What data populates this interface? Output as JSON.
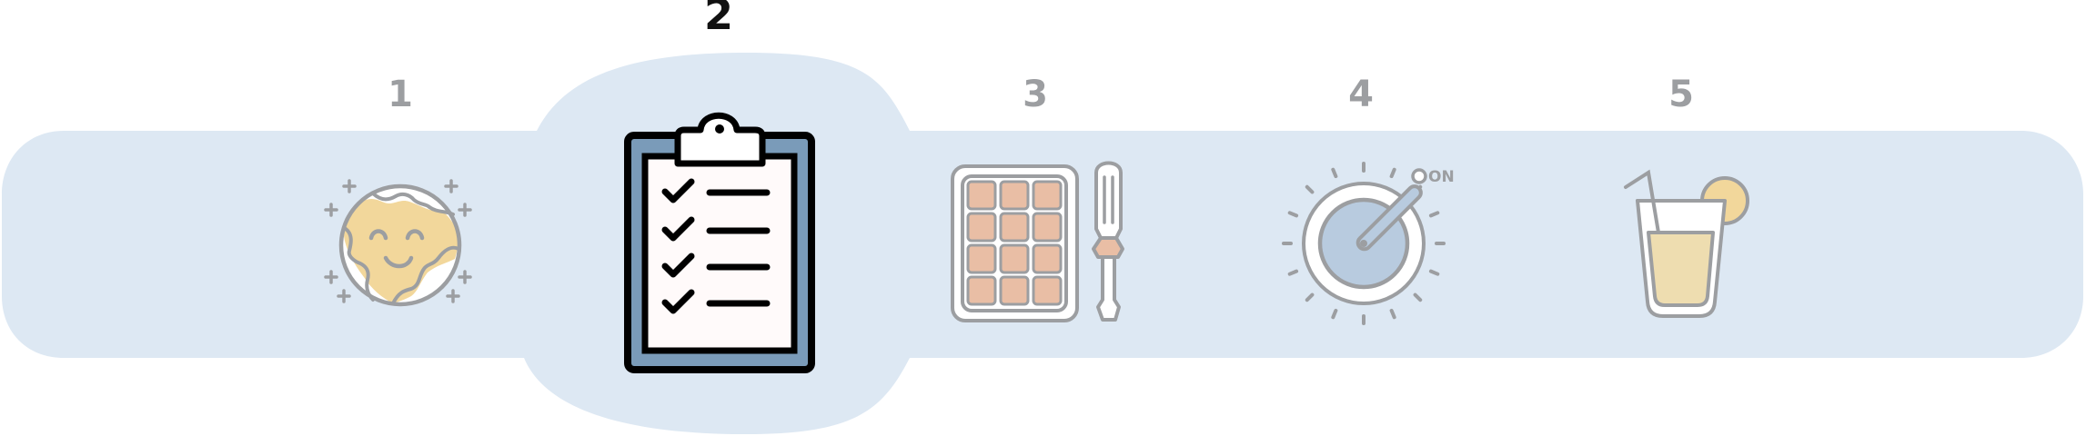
{
  "colors": {
    "band": "#dde8f3",
    "stroke_inactive": "#9c9ea1",
    "stroke_active": "#000000",
    "number_inactive": "#9c9ea1",
    "number_active": "#111111",
    "paper": "#fffafa",
    "board": "#7a9bb9",
    "yellow": "#f2d79b",
    "peach": "#e9bea5",
    "dial": "#b8cbdf",
    "lemonade": "#eeddb0",
    "white": "#ffffff"
  },
  "active_step": 2,
  "steps": [
    {
      "number": "1",
      "icon": "planet-icon"
    },
    {
      "number": "2",
      "icon": "clipboard-checklist-icon"
    },
    {
      "number": "3",
      "icon": "circuit-board-and-screwdriver-icon"
    },
    {
      "number": "4",
      "icon": "power-dial-icon"
    },
    {
      "number": "5",
      "icon": "lemonade-glass-icon"
    }
  ],
  "dial": {
    "on_label": "ON"
  }
}
